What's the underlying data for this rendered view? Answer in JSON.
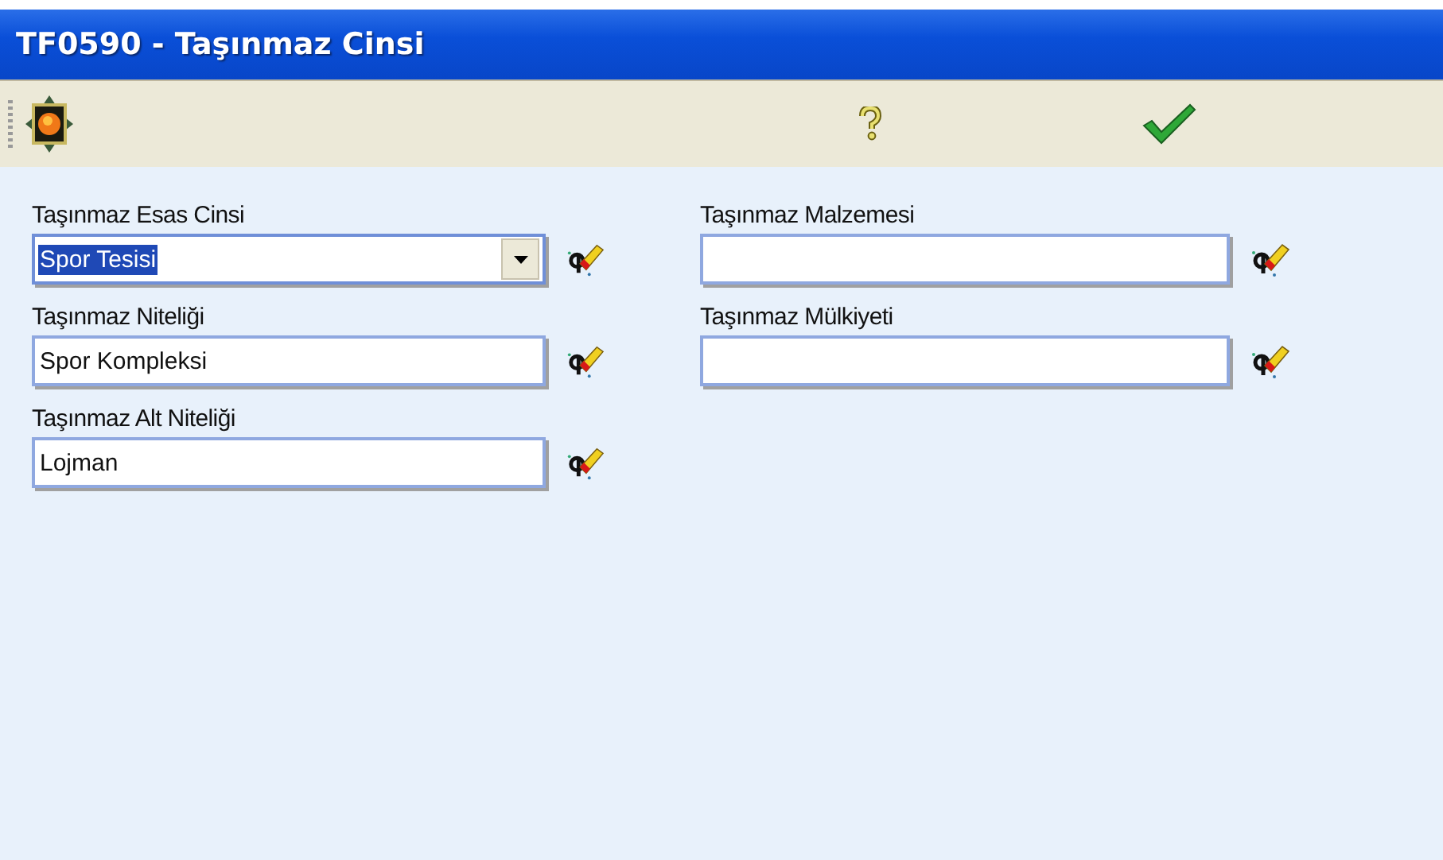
{
  "window": {
    "title": "TF0590 - Taşınmaz Cinsi"
  },
  "columns": [
    {
      "fields": [
        {
          "label": "Taşınmaz Esas Cinsi",
          "kind": "combo",
          "value": "Spor Tesisi",
          "selected": true
        },
        {
          "label": "Taşınmaz Niteliği",
          "kind": "text",
          "value": "Spor Kompleksi",
          "selected": false
        },
        {
          "label": "Taşınmaz Alt Niteliği",
          "kind": "text",
          "value": "Lojman",
          "selected": false
        }
      ]
    },
    {
      "fields": [
        {
          "label": "Taşınmaz Malzemesi",
          "kind": "text",
          "selected": false
        },
        {
          "label": "Taşınmaz Mülkiyeti",
          "kind": "text",
          "selected": false
        }
      ]
    }
  ]
}
